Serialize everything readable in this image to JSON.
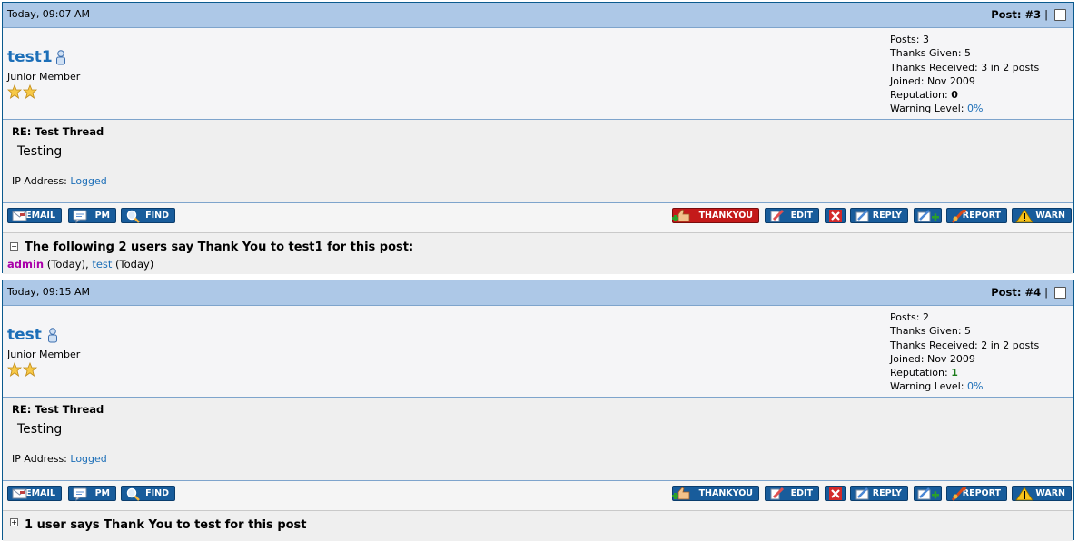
{
  "posts": [
    {
      "date": "Today, 09:07 AM",
      "post_label": "Post: #3",
      "separator": "|",
      "username": "test1",
      "usertitle": "Junior Member",
      "stats": {
        "posts_label": "Posts:",
        "posts": "3",
        "thanks_given_label": "Thanks Given:",
        "thanks_given": "5",
        "thanks_received_label": "Thanks Received:",
        "thanks_received": "3 in 2 posts",
        "joined_label": "Joined:",
        "joined": "Nov 2009",
        "reputation_label": "Reputation:",
        "reputation": "0",
        "warning_label": "Warning Level:",
        "warning": "0%"
      },
      "title": "RE: Test Thread",
      "body": "Testing",
      "ip_label": "IP Address:",
      "ip_value": "Logged",
      "thanks_header": "The following 2 users say Thank You to test1 for this post:",
      "thanks_user1": "admin",
      "thanks_user1_when": " (Today), ",
      "thanks_user2": "test",
      "thanks_user2_when": " (Today)"
    },
    {
      "date": "Today, 09:15 AM",
      "post_label": "Post: #4",
      "separator": "|",
      "username": "test",
      "usertitle": "Junior Member",
      "stats": {
        "posts_label": "Posts:",
        "posts": "2",
        "thanks_given_label": "Thanks Given:",
        "thanks_given": "5",
        "thanks_received_label": "Thanks Received:",
        "thanks_received": "2 in 2 posts",
        "joined_label": "Joined:",
        "joined": "Nov 2009",
        "reputation_label": "Reputation:",
        "reputation": "1",
        "warning_label": "Warning Level:",
        "warning": "0%"
      },
      "title": "RE: Test Thread",
      "body": "Testing",
      "ip_label": "IP Address:",
      "ip_value": "Logged",
      "thanks_header": "1 user says Thank You to test for this post"
    }
  ],
  "buttons": {
    "email": "EMAIL",
    "pm": "PM",
    "find": "FIND",
    "thankyou": "THANKYOU",
    "edit": "EDIT",
    "reply": "REPLY",
    "report": "REPORT",
    "warn": "WARN"
  },
  "colors": {
    "header_bg": "#adc8e7",
    "button_bg": "#185c9b",
    "thankyou_active": "#c41a1a",
    "username": "#1d6fb8",
    "admin": "#aa00aa"
  },
  "icons": [
    "user-online-icon",
    "star-icon",
    "email-icon",
    "pm-icon",
    "find-icon",
    "thankyou-icon",
    "edit-icon",
    "delete-icon",
    "reply-icon",
    "multiquote-icon",
    "report-icon",
    "warn-icon",
    "collapse-icon",
    "expand-icon"
  ]
}
